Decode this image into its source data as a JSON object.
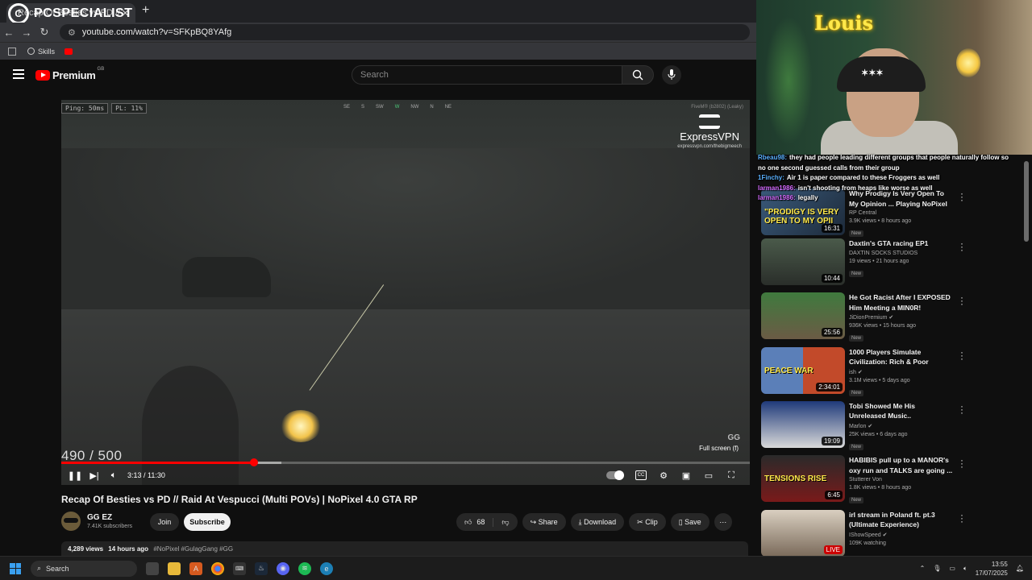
{
  "browser": {
    "tab_title": "Recap Of Besties vs PD // R",
    "overlay_brand": "PCSPECIALIST",
    "url": "youtube.com/watch?v=SFKpBQ8YAfg",
    "bookmarks": [
      {
        "label": "Skills"
      }
    ]
  },
  "masthead": {
    "logo_text": "Premium",
    "country_code": "GB",
    "search_placeholder": "Search"
  },
  "player": {
    "hud_ping": "Ping: 50ms",
    "hud_pl": "PL: 11%",
    "compass": [
      "SE",
      "S",
      "SW",
      "W",
      "NW",
      "N",
      "NE"
    ],
    "compass_active": "W",
    "game_tag": "FiveM® (b2802) (Leaky)",
    "sponsor_name": "ExpressVPN",
    "sponsor_url": "expressvpn.com/thebigmeech",
    "ammo": "490 / 500",
    "fullscreen_tip": "Full screen (f)",
    "watermark": "GG",
    "time": "3:13 / 11:30",
    "progress_played": 0.28,
    "progress_buffered": 0.32
  },
  "video": {
    "title": "Recap Of Besties vs PD // Raid At Vespucci (Multi POVs) | NoPixel 4.0 GTA RP",
    "channel": "GG EZ",
    "subscribers": "7.41K subscribers",
    "join_label": "Join",
    "subscribe_label": "Subscribe",
    "likes": "68",
    "share_label": "Share",
    "download_label": "Download",
    "clip_label": "Clip",
    "save_label": "Save",
    "views": "4,289 views",
    "age": "14 hours ago",
    "tags": "#NoPixel #GulagGang #GG"
  },
  "stream": {
    "streamer_name": "Louis",
    "chat": [
      {
        "user": "Rbeau98:",
        "text": "they had people leading different groups that people naturally follow so no one second guessed calls from their group",
        "sub": false
      },
      {
        "user": "1Finchy:",
        "text": "Air 1 is paper compared to these Froggers as well",
        "sub": false
      },
      {
        "user": "larman1986:",
        "text": "isn't shooting from heaps like worse as well",
        "sub": true
      },
      {
        "user": "larman1986:",
        "text": "legally",
        "sub": true
      }
    ]
  },
  "recommendations": [
    {
      "title": "Why Prodigy Is Very Open To My Opinion ... Playing NoPixel & what He Lik...",
      "channel": "RP Central",
      "views": "3.9K views • 8 hours ago",
      "duration": "16:31",
      "badge": "New",
      "thumb_text": "\"PRODIGY IS VERY OPEN TO MY OPII",
      "verified": false
    },
    {
      "title": "Daxtin's GTA racing EP1",
      "channel": "DAXTIN SOCKS STUDIOS",
      "views": "19 views • 21 hours ago",
      "duration": "10:44",
      "badge": "New",
      "thumb_text": "",
      "verified": false
    },
    {
      "title": "He Got Racist After I EXPOSED Him Meeting a MIN0R!",
      "channel": "JiDionPremium",
      "views": "936K views • 15 hours ago",
      "duration": "25:56",
      "badge": "New",
      "thumb_text": "",
      "verified": true
    },
    {
      "title": "1000 Players Simulate Civilization: Rich & Poor",
      "channel": "ish",
      "views": "3.1M views • 5 days ago",
      "duration": "2:34:01",
      "badge": "New",
      "thumb_text": "PEACE   WAR",
      "verified": true
    },
    {
      "title": "Tobi Showed Me His Unreleased Music..",
      "channel": "Marlon",
      "views": "25K views • 6 days ago",
      "duration": "19:09",
      "badge": "New",
      "thumb_text": "",
      "verified": true
    },
    {
      "title": "HABIBIS pull up to a MANOR's oxy run and TALKS are going ...",
      "channel": "Stutterer Von",
      "views": "1.8K views • 8 hours ago",
      "duration": "6:45",
      "badge": "New",
      "thumb_text": "TENSIONS RISE",
      "verified": false
    },
    {
      "title": "irl stream in Poland ft. pt.3 (Ultimate Experience)",
      "channel": "IShowSpeed",
      "views": "109K watching",
      "duration": "LIVE",
      "badge": "",
      "thumb_text": "",
      "verified": true
    }
  ],
  "taskbar": {
    "search_label": "Search",
    "time": "13:55",
    "date": "17/07/2025"
  },
  "colors": {
    "accent": "#ff0000",
    "bg": "#0f0f0f"
  }
}
